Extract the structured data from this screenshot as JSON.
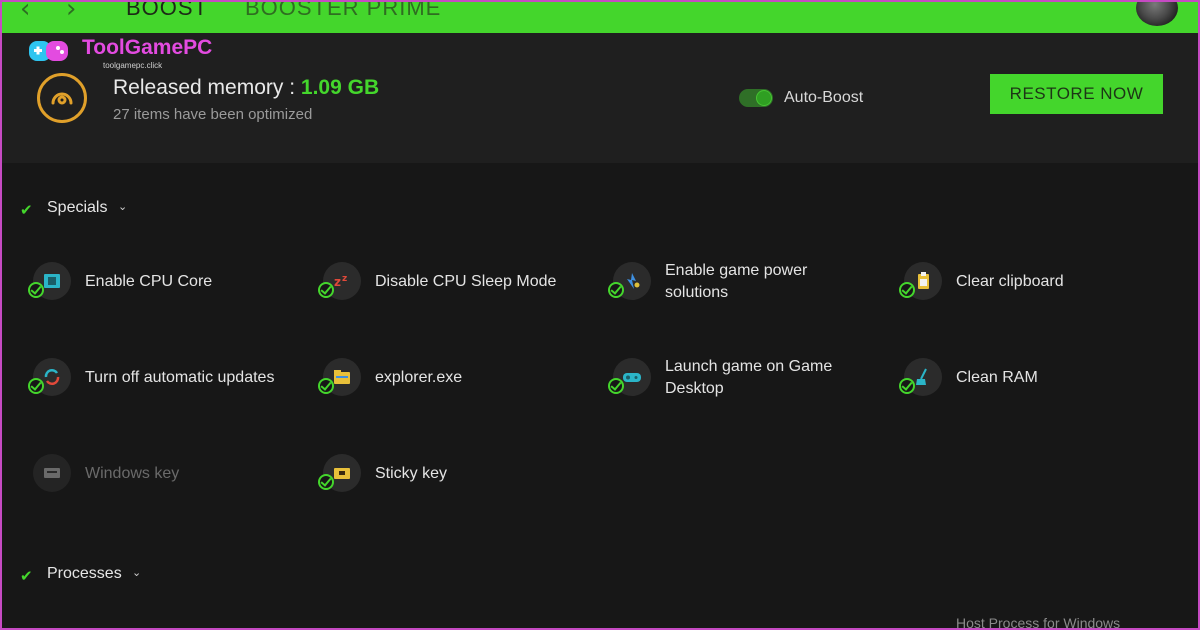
{
  "nav": {
    "back_icon": "‹",
    "forward_icon": "›",
    "tabs": [
      "BOOST",
      "BOOSTER PRIME"
    ]
  },
  "logo": {
    "name": "ToolGamePC",
    "url": "toolgamepc.click"
  },
  "header": {
    "memory_label": "Released memory : ",
    "memory_value": "1.09 GB",
    "optimized_text": "27 items have been optimized",
    "auto_boost_label": "Auto-Boost",
    "auto_boost_on": true,
    "restore_label": "RESTORE NOW"
  },
  "sections": {
    "specials": {
      "title": "Specials",
      "items": [
        {
          "label": "Enable CPU Core",
          "icon": "cpu-core-icon",
          "enabled": true
        },
        {
          "label": "Disable CPU Sleep Mode",
          "icon": "sleep-mode-icon",
          "enabled": true
        },
        {
          "label": "Enable game power solutions",
          "icon": "power-solutions-icon",
          "enabled": true
        },
        {
          "label": "Clear clipboard",
          "icon": "clipboard-icon",
          "enabled": true
        },
        {
          "label": "Turn off automatic updates",
          "icon": "updates-icon",
          "enabled": true
        },
        {
          "label": "explorer.exe",
          "icon": "folder-icon",
          "enabled": true
        },
        {
          "label": "Launch game on Game Desktop",
          "icon": "game-desktop-icon",
          "enabled": true
        },
        {
          "label": "Clean RAM",
          "icon": "broom-icon",
          "enabled": true
        },
        {
          "label": "Windows key",
          "icon": "keyboard-icon",
          "enabled": false
        },
        {
          "label": "Sticky key",
          "icon": "sticky-key-icon",
          "enabled": true
        }
      ]
    },
    "processes": {
      "title": "Processes",
      "footer_item": "Host Process for Windows"
    }
  },
  "colors": {
    "accent": "#44d62c",
    "background": "#171717",
    "panel": "#1f1f1f",
    "memory_ring": "#e0a02a",
    "logo": "#e34be0"
  }
}
